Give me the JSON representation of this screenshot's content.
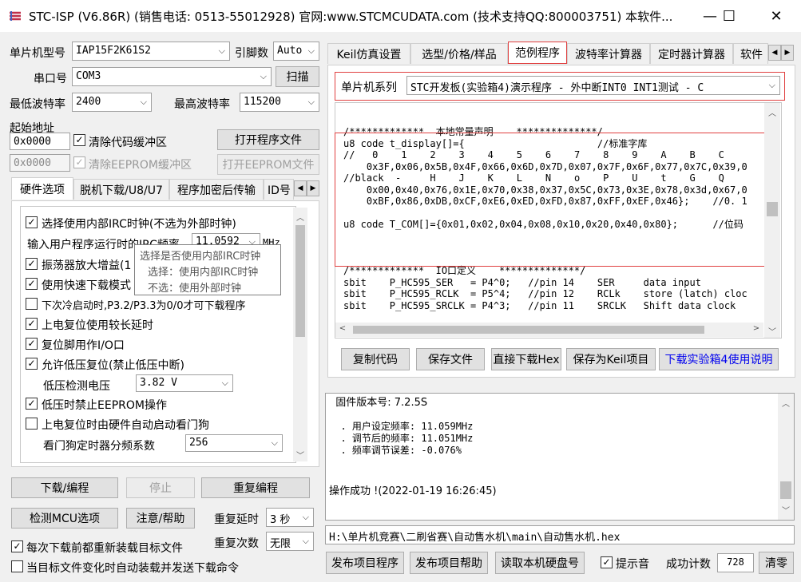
{
  "title": "STC-ISP (V6.86R) (销售电话: 0513-55012928) 官网:www.STCMCUDATA.com  (技术支持QQ:800003751) 本软件...",
  "window_controls": {
    "minimize": "—",
    "maximize": "☐",
    "close": "✕"
  },
  "left": {
    "mcu_model_label": "单片机型号",
    "mcu_model": "IAP15F2K61S2",
    "pin_count_label": "引脚数",
    "pin_count": "Auto",
    "serial_label": "串口号",
    "serial_port": "COM3",
    "scan_button": "扫描",
    "min_baud_label": "最低波特率",
    "min_baud": "2400",
    "max_baud_label": "最高波特率",
    "max_baud": "115200",
    "start_addr_label": "起始地址",
    "start_addr_1": "0x0000",
    "start_addr_2": "0x0000",
    "clear_code_label": "清除代码缓冲区",
    "clear_eeprom_label": "清除EEPROM缓冲区",
    "open_program_button": "打开程序文件",
    "open_eeprom_button": "打开EEPROM文件",
    "tabs": [
      "硬件选项",
      "脱机下载/U8/U7",
      "程序加密后传输",
      "ID号"
    ],
    "options": {
      "opt1": "选择使用内部IRC时钟(不选为外部时钟)",
      "irc_label": "输入用户程序运行时的IRC频率",
      "irc_value": "11.0592",
      "irc_unit": "MHz",
      "opt2": "振荡器放大增益(1",
      "opt3": "使用快速下载模式",
      "opt4": "下次冷启动时,P3.2/P3.3为0/0才可下载程序",
      "opt5": "上电复位使用较长延时",
      "opt6": "复位脚用作I/O口",
      "opt7": "允许低压复位(禁止低压中断)",
      "lv_label": "低压检测电压",
      "lv_value": "3.82 V",
      "opt8": "低压时禁止EEPROM操作",
      "opt9": "上电复位时由硬件自动启动看门狗",
      "wdt_label": "看门狗定时器分频系数",
      "wdt_value": "256"
    },
    "tooltip": {
      "line1": "选择是否使用内部IRC时钟",
      "line2": "选择：使用内部IRC时钟",
      "line3": "不选：使用外部时钟"
    },
    "download_button": "下载/编程",
    "stop_button": "停止",
    "reprogram_button": "重复编程",
    "detect_button": "检测MCU选项",
    "help_button": "注意/帮助",
    "repeat_delay_label": "重复延时",
    "repeat_delay": "3 秒",
    "repeat_count_label": "重复次数",
    "repeat_count": "无限",
    "reload_label": "每次下载前都重新装载目标文件",
    "auto_send_label": "当目标文件变化时自动装载并发送下载命令"
  },
  "right": {
    "tabs": [
      "Keil仿真设置",
      "选型/价格/样品",
      "范例程序",
      "波特率计算器",
      "定时器计算器",
      "软件"
    ],
    "series_label": "单片机系列",
    "series_value": "STC开发板(实验箱4)演示程序 - 外中断INT0 INT1测试 - C",
    "code_lines": [
      "",
      "",
      "/*************  本地常量声明    **************/",
      "u8 code t_display[]={                       //标准字库",
      "//   0    1    2    3    4    5    6    7    8    9    A    B    C",
      "    0x3F,0x06,0x5B,0x4F,0x66,0x6D,0x7D,0x07,0x7F,0x6F,0x77,0x7C,0x39,0",
      "//black  -     H    J    K    L    N    o    P    U    t    G    Q",
      "    0x00,0x40,0x76,0x1E,0x70,0x38,0x37,0x5C,0x73,0x3E,0x78,0x3d,0x67,0",
      "    0xBF,0x86,0xDB,0xCF,0xE6,0xED,0xFD,0x87,0xFF,0xEF,0x46};    //0. 1",
      "",
      "u8 code T_COM[]={0x01,0x02,0x04,0x08,0x10,0x20,0x40,0x80};      //位码",
      "",
      "",
      "",
      "/*************  IO口定义    **************/",
      "sbit    P_HC595_SER   = P4^0;   //pin 14    SER     data input",
      "sbit    P_HC595_RCLK  = P5^4;   //pin 12    RCLk    store (latch) cloc",
      "sbit    P_HC595_SRCLK = P4^3;   //pin 11    SRCLK   Shift data clock"
    ],
    "copy_code_button": "复制代码",
    "save_file_button": "保存文件",
    "direct_download_button": "直接下载Hex",
    "save_keil_button": "保存为Keil项目",
    "download_manual_link": "下载实验箱4使用说明",
    "log_lines": [
      "  固件版本号: 7.2.5S",
      "",
      "  . 用户设定频率: 11.059MHz",
      "  . 调节后的频率: 11.051MHz",
      "  . 频率调节误差: -0.076%",
      "",
      "",
      "操作成功 !(2022-01-19 16:26:45)"
    ],
    "file_path": "H:\\单片机竞赛\\二刷省赛\\自动售水机\\main\\自动售水机.hex",
    "publish_program_button": "发布项目程序",
    "publish_help_button": "发布项目帮助",
    "read_disk_button": "读取本机硬盘号",
    "beep_label": "提示音",
    "success_count_label": "成功计数",
    "success_count": "728",
    "clear_button": "清零"
  },
  "colors": {
    "accent_red": "#e04040",
    "link_blue": "#0000ee"
  }
}
